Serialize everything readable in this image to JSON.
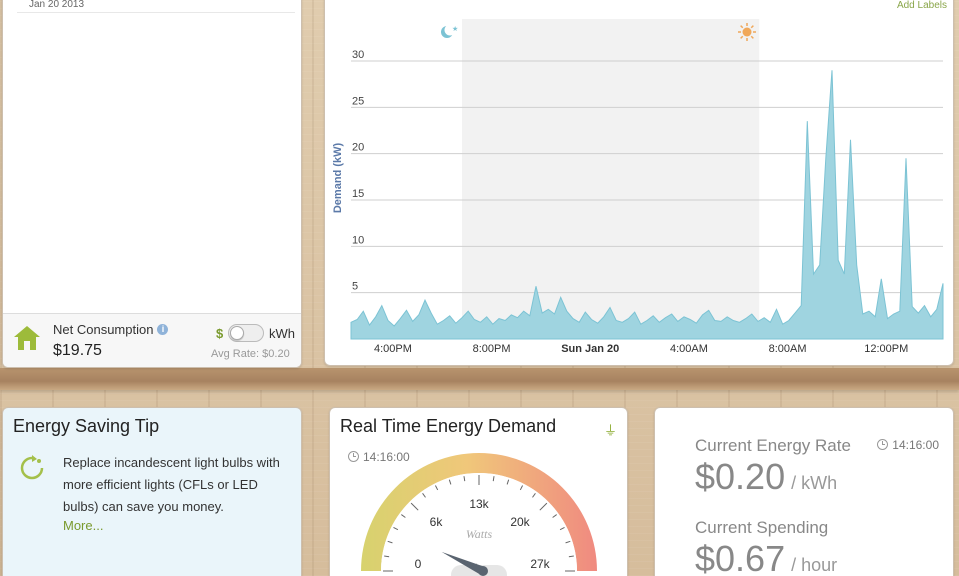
{
  "left_panel": {
    "date_label": "Jan 20 2013",
    "net_consumption_label": "Net Consumption",
    "net_consumption_value": "$19.75",
    "toggle_left_label": "$",
    "toggle_right_label": "kWh",
    "avg_rate": "Avg Rate: $0.20"
  },
  "chart_panel": {
    "add_labels": "Add Labels",
    "night_icon": "moon-stars-icon",
    "day_icon": "sun-icon",
    "colors": {
      "area": "#9fd4e0",
      "area_stroke": "#7cc3d4",
      "night_band": "#f2f2f2",
      "axis_label": "#5b79a8"
    }
  },
  "chart_data": {
    "type": "area",
    "ylabel": "Demand (kW)",
    "ylim": [
      0,
      30
    ],
    "yticks": [
      0,
      5,
      10,
      15,
      20,
      25,
      30
    ],
    "xticks": [
      "4:00PM",
      "8:00PM",
      "Sun Jan 20",
      "4:00AM",
      "8:00AM",
      "12:00PM"
    ],
    "x_hours": [
      14.8,
      24.0
    ],
    "note_units": "x in hours after Jan 19 14:00 start of view window",
    "night_band_hours": [
      18.5,
      30.6
    ],
    "x": [
      0.0,
      0.25,
      0.5,
      0.75,
      1.0,
      1.25,
      1.5,
      1.75,
      2.0,
      2.25,
      2.5,
      2.75,
      3.0,
      3.25,
      3.5,
      3.75,
      4.0,
      4.25,
      4.5,
      4.75,
      5.0,
      5.25,
      5.5,
      5.75,
      6.0,
      6.25,
      6.5,
      6.75,
      7.0,
      7.25,
      7.5,
      7.75,
      8.0,
      8.25,
      8.5,
      8.75,
      9.0,
      9.25,
      9.5,
      9.75,
      10.0,
      10.25,
      10.5,
      10.75,
      11.0,
      11.25,
      11.5,
      11.75,
      12.0,
      12.25,
      12.5,
      12.75,
      13.0,
      13.25,
      13.5,
      13.75,
      14.0,
      14.25,
      14.5,
      14.75,
      15.0,
      15.25,
      15.5,
      15.75,
      16.0,
      16.25,
      16.5,
      16.75,
      17.0,
      17.25,
      17.5,
      17.75,
      18.0,
      18.25,
      18.5,
      18.75,
      19.0,
      19.25,
      19.5,
      19.75,
      20.0,
      20.25,
      20.5,
      20.75,
      21.0,
      21.25,
      21.5,
      21.75,
      22.0,
      22.25,
      22.5,
      22.75,
      23.0,
      23.25,
      23.5,
      23.75,
      24.0
    ],
    "values": [
      1.8,
      2.1,
      3.0,
      1.5,
      2.4,
      3.6,
      2.0,
      1.4,
      2.2,
      3.1,
      1.9,
      2.6,
      4.2,
      2.8,
      1.6,
      2.0,
      2.5,
      1.7,
      2.3,
      3.0,
      2.1,
      1.8,
      2.4,
      1.6,
      2.2,
      2.0,
      2.6,
      2.3,
      3.0,
      2.5,
      5.7,
      2.8,
      3.2,
      2.7,
      4.5,
      3.0,
      2.2,
      1.8,
      2.9,
      2.1,
      1.7,
      2.4,
      3.4,
      2.0,
      1.8,
      2.2,
      2.9,
      1.6,
      2.0,
      2.5,
      1.8,
      2.3,
      2.7,
      1.9,
      2.4,
      2.1,
      1.7,
      2.6,
      3.1,
      2.0,
      1.9,
      2.4,
      2.0,
      1.8,
      2.2,
      2.7,
      1.9,
      2.3,
      1.8,
      3.2,
      1.6,
      2.0,
      2.8,
      3.6,
      23.5,
      7.0,
      8.0,
      19.5,
      29.0,
      8.5,
      7.0,
      21.5,
      8.0,
      2.7,
      3.0,
      2.4,
      6.5,
      2.2,
      2.7,
      3.0,
      19.5,
      3.5,
      2.8,
      3.6,
      2.4,
      3.2,
      6.0
    ]
  },
  "tip_card": {
    "title": "Energy Saving Tip",
    "text": "Replace incandescent light bulbs with more efficient lights (CFLs or LED bulbs) can save you money.",
    "more_link": "More..."
  },
  "demand_card": {
    "title": "Real Time Energy Demand",
    "time": "14:16:00",
    "gauge_labels": [
      "0",
      "6k",
      "13k",
      "20k",
      "27k"
    ],
    "gauge_unit": "Watts",
    "gauge_value_fraction": 0.15
  },
  "rate_card": {
    "rate_label": "Current Energy Rate",
    "rate_time": "14:16:00",
    "rate_value": "$0.20",
    "rate_unit": "/ kWh",
    "spend_label": "Current Spending",
    "spend_value": "$0.67",
    "spend_unit": "/ hour"
  }
}
